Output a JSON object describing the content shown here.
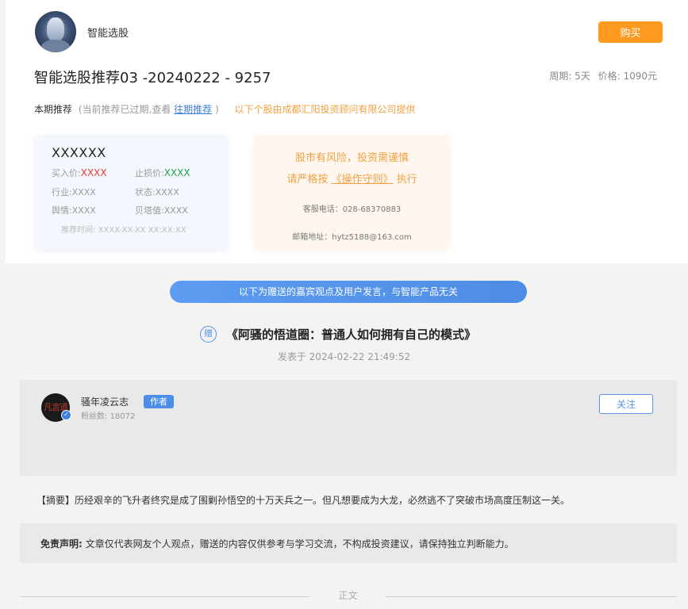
{
  "header": {
    "brand": "智能选股",
    "buy_label": "购买",
    "title": "智能选股推荐03 -20240222 - 9257",
    "period_label": "周期:",
    "period_value": "5天",
    "price_label": "价格:",
    "price_value": "1090元"
  },
  "recommend": {
    "label": "本期推荐",
    "note_prefix": "(当前推荐已过期,查看",
    "note_link": "往期推荐",
    "note_suffix": ")",
    "provider": "以下个股由成都汇阳投资顾问有限公司提供"
  },
  "stock_card": {
    "name": "XXXXXX",
    "buy_label": "买入价:",
    "buy_value": "XXXX",
    "stop_label": "止损价:",
    "stop_value": "XXXX",
    "industry_label": "行业:",
    "industry_value": "XXXX",
    "status_label": "状态:",
    "status_value": "XXXX",
    "sentiment_label": "舆情:",
    "sentiment_value": "XXXX",
    "beta_label": "贝塔值:",
    "beta_value": "XXXX",
    "time_label": "推荐时间:",
    "time_value": "XXXX-XX-XX XX:XX:XX"
  },
  "risk_card": {
    "line1": "股市有风险，投资需谨慎",
    "line2_prefix": "请严格按",
    "line2_link": "《操作守则》",
    "line2_suffix": "执行",
    "phone": "客服电话：028-68370883",
    "email": "邮箱地址：hytz5188@163.com"
  },
  "banner": "以下为赠送的嘉宾观点及用户发言，与智能产品无关",
  "article": {
    "gift_badge": "赠",
    "title": "《阿骚的悟道圈：普通人如何拥有自己的模式》",
    "published": "发表于 2024-02-22 21:49:52"
  },
  "author": {
    "name": "骚年凌云志",
    "tag": "作者",
    "fans_label": "粉丝数:",
    "fans_value": "18072",
    "follow_label": "关注"
  },
  "summary": "【摘要】历经艰辛的飞升者终究是成了围剿孙悟空的十万天兵之一。但凡想要成为大龙，必然逃不了突破市场高度压制这一关。",
  "disclaimer": {
    "label": "免责声明:",
    "text": "文章仅代表网友个人观点，赠送的内容仅供参考与学习交流，不构成投资建议，请保持独立判断能力。"
  },
  "body_divider": "正文",
  "colors": {
    "accent_orange": "#ff9a1f",
    "accent_blue": "#4d8de6",
    "price_red": "#e53b2c",
    "price_green": "#1ea24a"
  }
}
